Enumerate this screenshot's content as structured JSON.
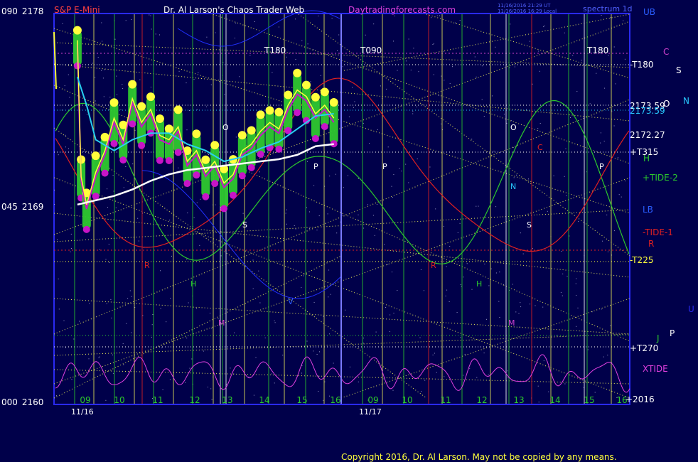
{
  "header": {
    "symbol": "S&P E-Mini",
    "title": "Dr. Al Larson's Chaos Trader Web",
    "site": "Daytradingforecasts.com",
    "stamp_line1": "11/16/2016 21:29 UT",
    "stamp_line2": "11/16/2016 16:29 Local",
    "spectrum": "spectrum 1d"
  },
  "footer": {
    "copyright": "Copyright 2016, Dr. Al Larson. May not be copied by any means."
  },
  "colors": {
    "background": "#00004a",
    "frame": "#2a2af2",
    "grid_yellow": "#e6e65a",
    "price_green": "#2ec82e",
    "price_yellow": "#ffff3c",
    "price_magenta": "#c814c8",
    "ema_cyan": "#28d0f0",
    "ema_white": "#ffffff",
    "tide_green": "#2cc82c",
    "tide_red": "#e02020",
    "xtide_magenta": "#e040e0",
    "lb_blue": "#2030ff"
  },
  "chart_data": {
    "type": "line",
    "title": "S&P E-Mini",
    "price_axis_left": [
      {
        "code": "090",
        "price": "2178"
      },
      {
        "code": "045",
        "price": "2169"
      },
      {
        "code": "000",
        "price": "2160"
      }
    ],
    "ylim": [
      2160,
      2178
    ],
    "x_hours": [
      "09",
      "10",
      "11",
      "12",
      "13",
      "14",
      "15",
      "16",
      "09",
      "10",
      "11",
      "12",
      "13",
      "14",
      "15",
      "16"
    ],
    "dates": [
      "11/16",
      "11/17"
    ],
    "series": [
      {
        "name": "price",
        "x": [
          9.0,
          9.1,
          9.25,
          9.5,
          9.75,
          10.0,
          10.25,
          10.5,
          10.75,
          11.0,
          11.25,
          11.5,
          11.75,
          12.0,
          12.25,
          12.5,
          12.75,
          13.0,
          13.25,
          13.5,
          13.75,
          14.0,
          14.25,
          14.5,
          14.75,
          15.0,
          15.25,
          15.5,
          15.75,
          16.0
        ],
        "values": [
          2176.6,
          2170.3,
          2169.0,
          2170.5,
          2171.5,
          2173.0,
          2172.0,
          2173.9,
          2172.8,
          2173.4,
          2172.2,
          2172.0,
          2172.6,
          2171.0,
          2171.5,
          2170.5,
          2171.0,
          2170.0,
          2170.4,
          2171.5,
          2171.8,
          2172.4,
          2172.8,
          2172.5,
          2173.6,
          2174.3,
          2174.0,
          2173.2,
          2173.6,
          2173.0
        ]
      },
      {
        "name": "ema fast",
        "x": [
          9.0,
          9.25,
          9.5,
          10.0,
          10.5,
          11.0,
          11.5,
          12.0,
          12.5,
          13.0,
          13.5,
          14.0,
          14.5,
          15.0,
          15.5,
          16.0
        ],
        "values": [
          2175.1,
          2173.8,
          2172.2,
          2171.7,
          2172.2,
          2172.5,
          2172.5,
          2172.0,
          2171.7,
          2171.2,
          2171.4,
          2171.8,
          2172.1,
          2172.7,
          2173.3,
          2173.4
        ]
      },
      {
        "name": "ema slow",
        "x": [
          9.0,
          9.5,
          10.0,
          10.5,
          11.0,
          11.5,
          12.0,
          12.5,
          13.0,
          13.5,
          14.0,
          14.5,
          15.0,
          15.5,
          16.0
        ],
        "values": [
          2169.2,
          2169.4,
          2169.6,
          2169.9,
          2170.3,
          2170.6,
          2170.8,
          2170.9,
          2171.0,
          2171.1,
          2171.2,
          2171.3,
          2171.5,
          2171.9,
          2172.0
        ]
      }
    ],
    "right_labels": [
      {
        "text": "UB",
        "color": "#2a5cff"
      },
      {
        "text": "-T180",
        "color": "#ffffff"
      },
      {
        "text": "C",
        "color": "#d040d0"
      },
      {
        "text": "S",
        "color": "#ffffff"
      },
      {
        "text": "N",
        "color": "#28c8ff"
      },
      {
        "text": "2173.59",
        "color": "#ffffff"
      },
      {
        "text": "2173.59",
        "color": "#28c8ff"
      },
      {
        "text": "O",
        "color": "#ffffff"
      },
      {
        "text": "2172.27",
        "color": "#ffffff"
      },
      {
        "text": "+T315",
        "color": "#ffffff"
      },
      {
        "text": "H",
        "color": "#2cc82c"
      },
      {
        "text": "+TIDE-2",
        "color": "#2cc82c"
      },
      {
        "text": "LB",
        "color": "#2a5cff"
      },
      {
        "text": "-TIDE-1",
        "color": "#e02020"
      },
      {
        "text": "R",
        "color": "#e02020"
      },
      {
        "text": "-T225",
        "color": "#ffff3c"
      },
      {
        "text": "U",
        "color": "#2a2af2"
      },
      {
        "text": "P",
        "color": "#ffffff"
      },
      {
        "text": "J",
        "color": "#2cc82c"
      },
      {
        "text": "+T270",
        "color": "#ffffff"
      },
      {
        "text": "XTIDE",
        "color": "#e040e0"
      },
      {
        "text": "+2016",
        "color": "#ffffff"
      }
    ],
    "top_labels": [
      "T180",
      "T090",
      "T180"
    ],
    "plot_markers": [
      "P",
      "O",
      "N",
      "S",
      "H",
      "R",
      "M",
      "C",
      "V"
    ]
  }
}
